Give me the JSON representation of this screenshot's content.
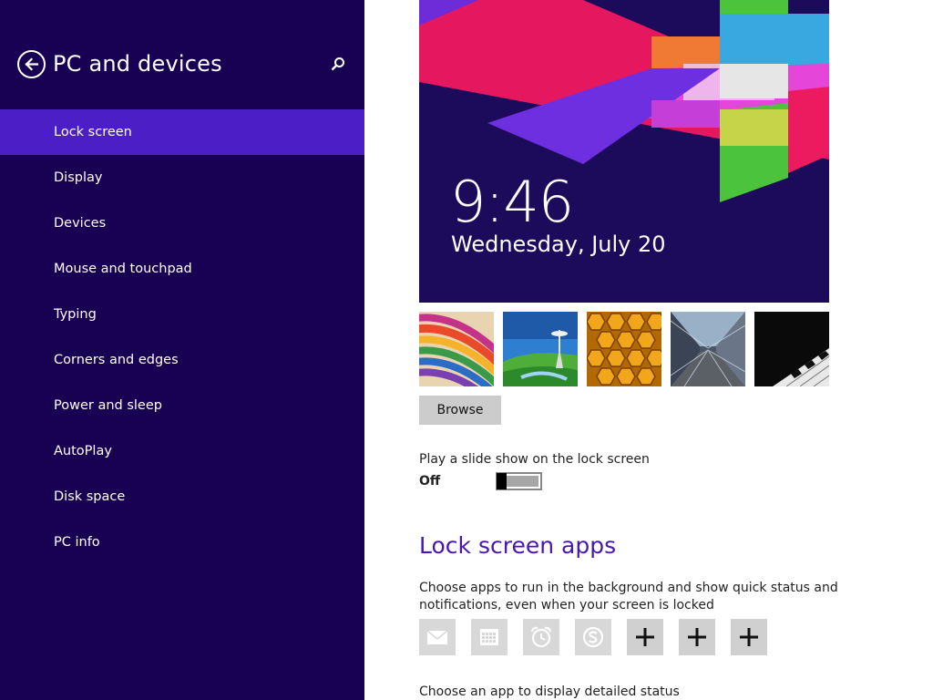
{
  "sidebar": {
    "title": "PC and devices",
    "back_icon": "back-arrow-icon",
    "search_icon": "search-icon",
    "items": [
      {
        "label": "Lock screen",
        "selected": true
      },
      {
        "label": "Display"
      },
      {
        "label": "Devices"
      },
      {
        "label": "Mouse and touchpad"
      },
      {
        "label": "Typing"
      },
      {
        "label": "Corners and edges"
      },
      {
        "label": "Power and sleep"
      },
      {
        "label": "AutoPlay"
      },
      {
        "label": "Disk space"
      },
      {
        "label": "PC info"
      }
    ]
  },
  "preview": {
    "time": "9:46",
    "date": "Wednesday, July 20"
  },
  "thumbnails": [
    {
      "name": "colorful-stripes"
    },
    {
      "name": "space-needle"
    },
    {
      "name": "honeycomb"
    },
    {
      "name": "motion-tunnel"
    },
    {
      "name": "piano-keys"
    }
  ],
  "browse_label": "Browse",
  "slideshow": {
    "label": "Play a slide show on the lock screen",
    "state": "Off"
  },
  "lock_screen_apps": {
    "heading": "Lock screen apps",
    "description": "Choose apps to run in the background and show quick status and notifications, even when your screen is locked",
    "slots": [
      {
        "icon": "mail-icon"
      },
      {
        "icon": "calendar-icon"
      },
      {
        "icon": "alarm-clock-icon"
      },
      {
        "icon": "skype-icon"
      },
      {
        "icon": "plus-icon"
      },
      {
        "icon": "plus-icon"
      },
      {
        "icon": "plus-icon"
      }
    ],
    "detail_label": "Choose an app to display detailed status"
  },
  "colors": {
    "sidebar_bg": "#180052",
    "selected_bg": "#4b1ec6",
    "accent": "#4617b4"
  }
}
